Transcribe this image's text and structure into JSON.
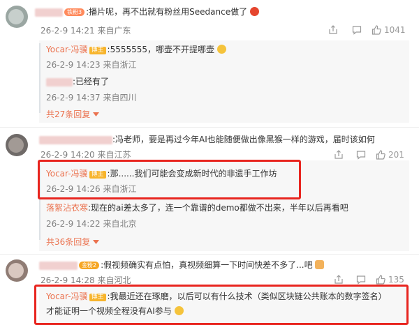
{
  "comments": [
    {
      "text": ":播片呢，再不出就有粉丝用Seedance做了",
      "fan_badge": "铁粉3",
      "time": "26-2-9 14:21",
      "location": "来自广东",
      "likes": "1041",
      "replies": [
        {
          "author": "Yocar-冯骥",
          "badge": "博主",
          "text": ":5555555，哪壶不开提哪壶",
          "time": "26-2-9 14:23",
          "location": "来自浙江"
        },
        {
          "text": ":已经有了",
          "time": "26-2-9 14:37",
          "location": "来自四川"
        }
      ],
      "more": "共27条回复"
    },
    {
      "text": ":冯老师，要是再过今年AI也能随便做出像黑猴一样的游戏，届时该如何",
      "time": "26-2-9 14:20",
      "location": "来自江苏",
      "likes": "201",
      "replies": [
        {
          "author": "Yocar-冯骥",
          "badge": "博主",
          "text": ":那......我们可能会变成新时代的非遗手工作坊",
          "time": "26-2-9 14:26",
          "location": "来自浙江"
        },
        {
          "author": "落絮沾衣寒",
          "text": ":现在的ai差太多了，连一个靠谱的demo都做不出来，半年以后再看吧",
          "time": "26-2-9 14:22",
          "location": "来自北京"
        }
      ],
      "more": "共36条回复"
    },
    {
      "text": ":假视频确实有点怕，真视频细算一下时间快差不多了...吧",
      "fan_badge": "金粉2",
      "time": "26-2-9 14:28",
      "location": "来自河北",
      "likes": "135",
      "replies": [
        {
          "author": "Yocar-冯骥",
          "badge": "博主",
          "text": ":我最近还在琢磨，以后可以有什么技术（类似区块链公共账本的数字签名）",
          "text2": "才能证明一个视频全程没有AI参与"
        }
      ]
    }
  ],
  "icons": [
    "share-icon",
    "comment-icon",
    "like-icon",
    "chevron-down-icon"
  ],
  "colors": {
    "accent": "#eb7350",
    "highlight_box": "#e8251f",
    "badge": "#f7b42c"
  }
}
